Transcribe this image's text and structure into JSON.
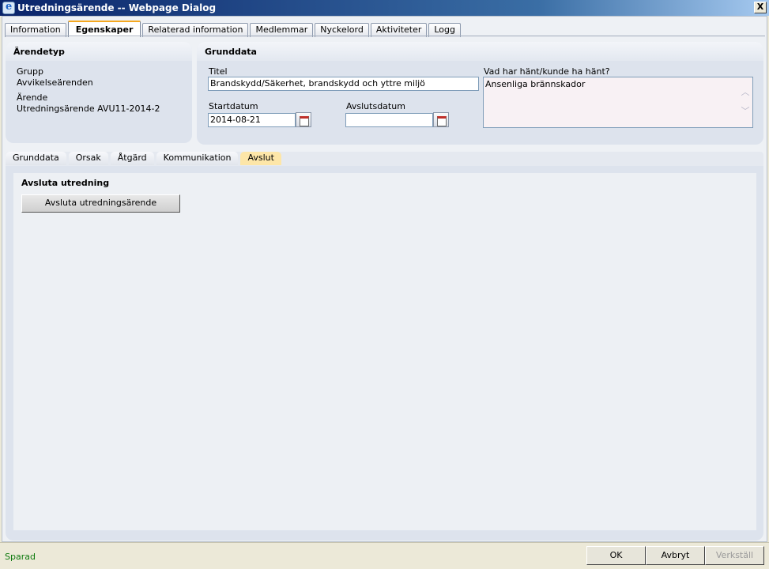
{
  "window": {
    "title": "Utredningsärende -- Webpage Dialog",
    "close": "X"
  },
  "tabs": [
    {
      "label": "Information"
    },
    {
      "label": "Egenskaper",
      "active": true
    },
    {
      "label": "Relaterad information"
    },
    {
      "label": "Medlemmar"
    },
    {
      "label": "Nyckelord"
    },
    {
      "label": "Aktiviteter"
    },
    {
      "label": "Logg"
    }
  ],
  "arendetyp": {
    "title": "Ärendetyp",
    "grupp_label": "Grupp",
    "grupp_value": "Avvikelseärenden",
    "arende_label": "Ärende",
    "arende_value": "Utredningsärende AVU11-2014-2"
  },
  "grunddata": {
    "title": "Grunddata",
    "titel_label": "Titel",
    "titel_value": "Brandskydd/Säkerhet, brandskydd och yttre miljö",
    "startdatum_label": "Startdatum",
    "startdatum_value": "2014-08-21",
    "avslutsdatum_label": "Avslutsdatum",
    "avslutsdatum_value": "",
    "vad_label": "Vad har hänt/kunde ha hänt?",
    "vad_value": "Ansenliga brännskador"
  },
  "subtabs": [
    {
      "label": "Grunddata"
    },
    {
      "label": "Orsak"
    },
    {
      "label": "Åtgärd"
    },
    {
      "label": "Kommunikation"
    },
    {
      "label": "Avslut",
      "active": true
    }
  ],
  "avslut": {
    "section_title": "Avsluta utredning",
    "button_label": "Avsluta utredningsärende"
  },
  "footer": {
    "status": "Sparad",
    "ok": "OK",
    "cancel": "Avbryt",
    "apply": "Verkställ"
  },
  "colors": {
    "titlebar": "#0a246a",
    "active_subtab": "#fde6a8",
    "status_text": "#0e7a0e"
  }
}
